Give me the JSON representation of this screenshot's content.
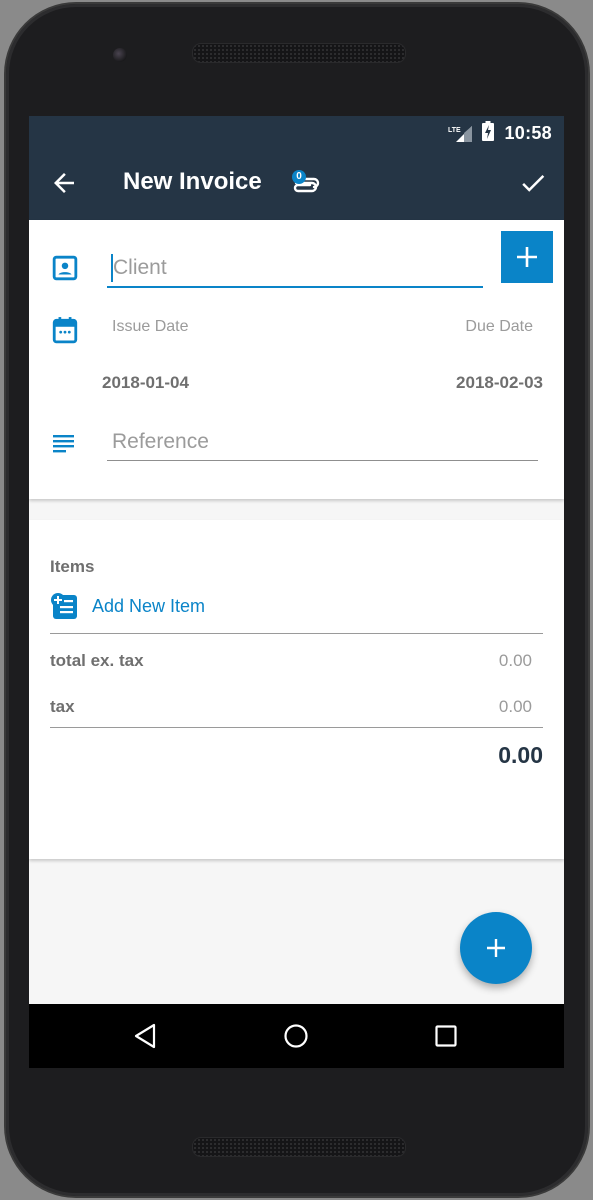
{
  "status_bar": {
    "network": "LTE",
    "time": "10:58"
  },
  "app_bar": {
    "title": "New Invoice",
    "attachment_count": "0",
    "icons": {
      "back": "arrow-back-icon",
      "attachment": "paperclip-icon",
      "save": "check-icon"
    }
  },
  "header_form": {
    "client": {
      "placeholder": "Client",
      "value": ""
    },
    "add_client_icon": "plus-icon",
    "issue_date": {
      "label": "Issue Date",
      "value": "2018-01-04"
    },
    "due_date": {
      "label": "Due Date",
      "value": "2018-02-03"
    },
    "reference": {
      "placeholder": "Reference",
      "value": ""
    }
  },
  "items_section": {
    "title": "Items",
    "add_item_label": "Add New Item",
    "totals": [
      {
        "label": "total ex. tax",
        "value": "0.00"
      },
      {
        "label": "tax",
        "value": "0.00"
      }
    ],
    "grand_total": "0.00"
  },
  "fab": {
    "icon": "plus-icon"
  },
  "nav_bar": {
    "buttons": [
      "back",
      "home",
      "recents"
    ]
  },
  "colors": {
    "primary_dark": "#253545",
    "accent": "#0a84c8",
    "text_grey": "#6f6f6f",
    "placeholder_grey": "#9b9b9b"
  }
}
